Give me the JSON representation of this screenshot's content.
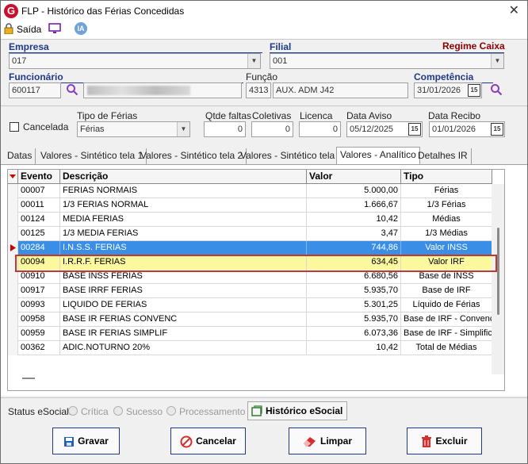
{
  "window": {
    "title": "FLP - Histórico das Férias Concedidas",
    "close_glyph": "✕"
  },
  "toolbar": {
    "exit_label": "Saída",
    "ia_label": "IA"
  },
  "form": {
    "empresa_label": "Empresa",
    "empresa_value": "017",
    "filial_label": "Filial",
    "filial_value": "001",
    "regime_label": "Regime Caixa",
    "funcionario_label": "Funcionário",
    "funcionario_value": "600117",
    "funcao_label": "Função",
    "funcao_code": "4313",
    "funcao_desc": "AUX. ADM J42",
    "competencia_label": "Competência",
    "competencia_value": "31/01/2026",
    "cancelada_label": "Cancelada",
    "tipo_ferias_label": "Tipo de Férias",
    "tipo_ferias_value": "Férias",
    "qtde_faltas_label": "Qtde faltas",
    "qtde_faltas_value": "0",
    "coletivas_label": "Coletivas",
    "coletivas_value": "0",
    "licenca_label": "Licenca",
    "licenca_value": "0",
    "data_aviso_label": "Data Aviso",
    "data_aviso_value": "05/12/2025",
    "data_recibo_label": "Data Recibo",
    "data_recibo_value": "01/01/2026",
    "cal_glyph": "15"
  },
  "tabs": [
    {
      "label": "Datas"
    },
    {
      "label": "Valores - Sintético tela 1"
    },
    {
      "label": "Valores - Sintético tela 2"
    },
    {
      "label": "Valores - Sintético tela 3"
    },
    {
      "label": "Valores - Analítico"
    },
    {
      "label": "Detalhes IR"
    }
  ],
  "grid": {
    "columns": [
      "Evento",
      "Descrição",
      "Valor",
      "Tipo"
    ],
    "rows": [
      {
        "evento": "00007",
        "descricao": "FERIAS NORMAIS",
        "valor": "5.000,00",
        "tipo": "Férias"
      },
      {
        "evento": "00011",
        "descricao": "1/3 FERIAS NORMAL",
        "valor": "1.666,67",
        "tipo": "1/3 Férias"
      },
      {
        "evento": "00124",
        "descricao": "MEDIA FERIAS",
        "valor": "10,42",
        "tipo": "Médias"
      },
      {
        "evento": "00125",
        "descricao": "1/3 MEDIA FERIAS",
        "valor": "3,47",
        "tipo": "1/3 Médias"
      },
      {
        "evento": "00284",
        "descricao": "I.N.S.S. FERIAS",
        "valor": "744,86",
        "tipo": "Valor INSS"
      },
      {
        "evento": "00094",
        "descricao": "I.R.R.F. FERIAS",
        "valor": "634,45",
        "tipo": "Valor IRF"
      },
      {
        "evento": "00910",
        "descricao": "BASE INSS FERIAS",
        "valor": "6.680,56",
        "tipo": "Base de INSS"
      },
      {
        "evento": "00917",
        "descricao": "BASE IRRF FERIAS",
        "valor": "5.935,70",
        "tipo": "Base de IRF"
      },
      {
        "evento": "00993",
        "descricao": "LIQUIDO DE FERIAS",
        "valor": "5.301,25",
        "tipo": "Líquido de Férias"
      },
      {
        "evento": "00958",
        "descricao": "BASE IR FERIAS CONVENC",
        "valor": "5.935,70",
        "tipo": "Base de IRF - Convenci"
      },
      {
        "evento": "00959",
        "descricao": "BASE IR FERIAS SIMPLIF",
        "valor": "6.073,36",
        "tipo": "Base de IRF - Simplifica"
      },
      {
        "evento": "00362",
        "descricao": "ADIC.NOTURNO 20%",
        "valor": "10,42",
        "tipo": "Total de Médias"
      }
    ]
  },
  "status": {
    "label": "Status eSocial:",
    "critica": "Crítica",
    "sucesso": "Sucesso",
    "processamento": "Processamento",
    "historico_button": "Histórico eSocial"
  },
  "buttons": {
    "gravar": "Gravar",
    "cancelar": "Cancelar",
    "limpar": "Limpar",
    "excluir": "Excluir"
  },
  "colors": {
    "accent_blue": "#1f3a8a",
    "selected_row": "#3a8ee6",
    "highlight_row": "#fbf89e",
    "highlight_border": "#c0392b",
    "brand_red": "#c8102e"
  }
}
